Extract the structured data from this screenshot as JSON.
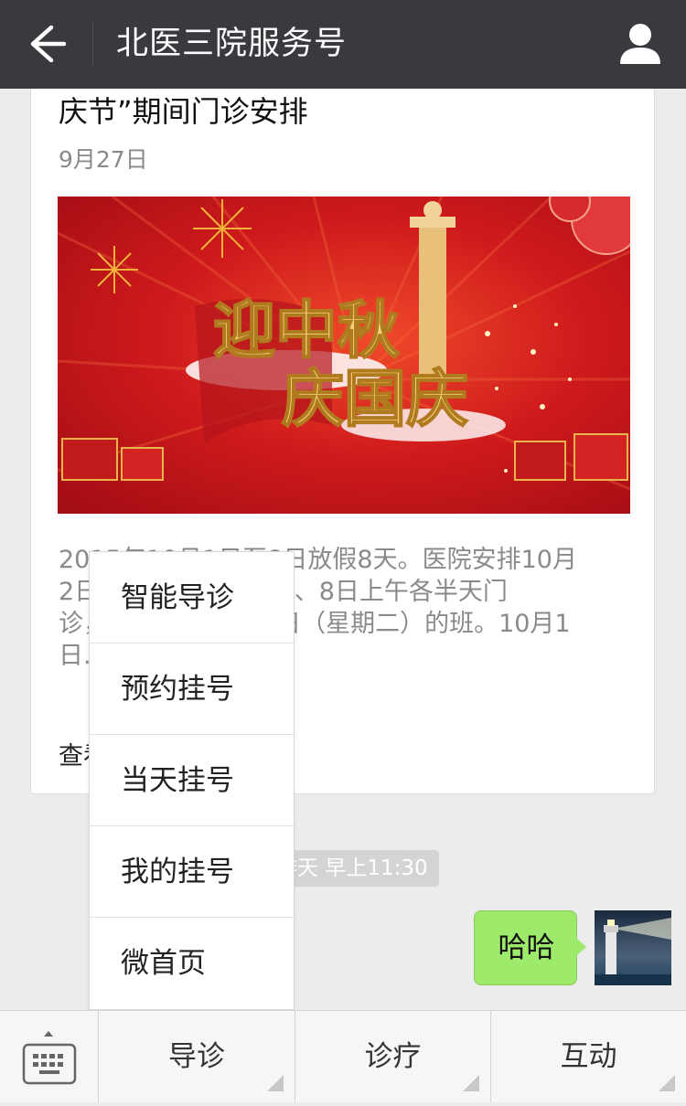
{
  "header": {
    "title": "北医三院服务号",
    "back_icon": "arrow-left-icon",
    "profile_icon": "person-icon"
  },
  "article": {
    "title": "庆节”期间门诊安排",
    "date": "9月27日",
    "banner_text_line1": "迎中秋",
    "banner_text_line2": "庆国庆",
    "description_lines": [
      "2015年10月1日至8日放假8天。医院安排10月",
      "2日、3日、4日、7日、8日上午各半天门",
      "诊，10月10日上13日（星期二）的班。10月1",
      "日..."
    ],
    "read_more": "查看全文"
  },
  "chat": {
    "timestamp": "昨天 早上11:30",
    "message": "哈哈"
  },
  "popup_menu": {
    "items": [
      "智能导诊",
      "预约挂号",
      "当天挂号",
      "我的挂号",
      "微首页"
    ]
  },
  "bottom_menu": {
    "keyboard_icon": "keyboard-icon",
    "items": [
      "导诊",
      "诊疗",
      "互动"
    ]
  },
  "colors": {
    "topbar": "#393a3f",
    "bubble": "#9eea6a",
    "banner_red": "#c8161d"
  }
}
